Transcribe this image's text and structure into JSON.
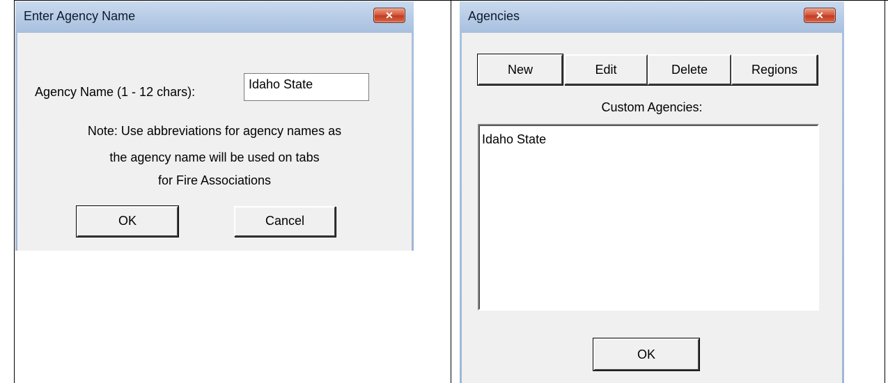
{
  "enter_dialog": {
    "title": "Enter Agency Name",
    "close_label": "✕",
    "name_label": "Agency Name (1 - 12 chars):",
    "name_value": "Idaho State",
    "note_lines": [
      "Note: Use abbreviations for agency names as",
      "the agency name will be used on tabs",
      "for Fire Associations"
    ],
    "ok_label": "OK",
    "cancel_label": "Cancel"
  },
  "agencies_dialog": {
    "title": "Agencies",
    "close_label": "✕",
    "toolbar": {
      "new_label": "New",
      "edit_label": "Edit",
      "delete_label": "Delete",
      "regions_label": "Regions"
    },
    "list_label": "Custom Agencies:",
    "items": [
      "Idaho State"
    ],
    "ok_label": "OK"
  },
  "colors": {
    "dialog_bg": "#f0f0f0",
    "titlebar": "#b6cbe6",
    "close_button": "#d5563a"
  }
}
